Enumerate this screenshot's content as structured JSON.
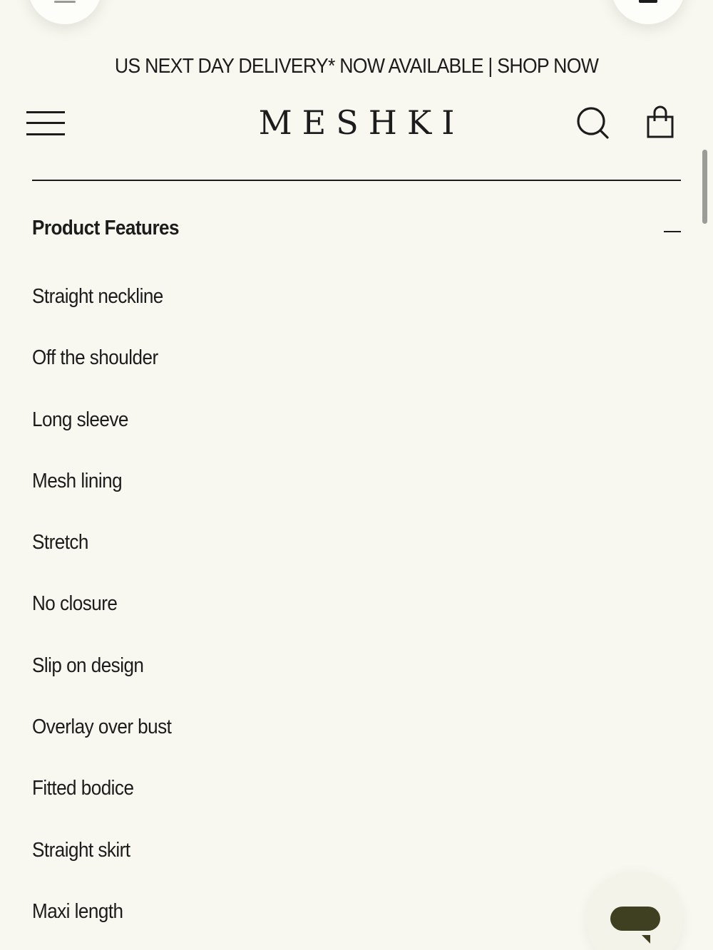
{
  "announcement": {
    "text": "US NEXT DAY DELIVERY* NOW AVAILABLE | SHOP NOW"
  },
  "header": {
    "logo": "MESHKI",
    "menu_icon": "hamburger-menu-icon",
    "search_icon": "search-icon",
    "cart_icon": "shopping-bag-icon"
  },
  "accordion": {
    "title": "Product Features",
    "state_icon": "minus-icon",
    "items": [
      "Straight neckline",
      "Off the shoulder",
      "Long sleeve",
      "Mesh lining",
      "Stretch",
      "No closure",
      "Slip on design",
      "Overlay over bust",
      "Fitted bodice",
      "Straight skirt",
      "Maxi length"
    ]
  },
  "chat": {
    "icon": "chat-bubble-icon",
    "color": "#3f3f22"
  },
  "colors": {
    "background": "#f9f8f0",
    "text": "#1c1c1c"
  }
}
